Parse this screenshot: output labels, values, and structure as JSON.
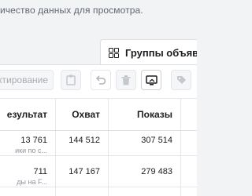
{
  "notice": "ичество данных для просмотра.",
  "tab": {
    "label": "Группы объяв",
    "icon": "grid-squares-icon"
  },
  "toolbar": {
    "edit_label": "ктирование",
    "buttons": [
      {
        "icon": "clipboard-icon"
      },
      {
        "icon": "undo-icon"
      },
      {
        "icon": "trash-icon"
      },
      {
        "icon": "preview-icon"
      },
      {
        "icon": "tag-icon"
      }
    ]
  },
  "table": {
    "headers": {
      "result": "езультат",
      "reach": "Охват",
      "impressions": "Показы"
    },
    "rows": [
      {
        "result": "13 761",
        "result_sub": "ики по с...",
        "reach": "144 512",
        "impressions": "307 514"
      },
      {
        "result": "711",
        "result_sub": "ды на F...",
        "reach": "147 167",
        "impressions": "279 483"
      }
    ]
  },
  "colors": {
    "accent": "#1877f2",
    "border": "#dddfe2",
    "muted": "#90949c",
    "text": "#1c1e21"
  }
}
